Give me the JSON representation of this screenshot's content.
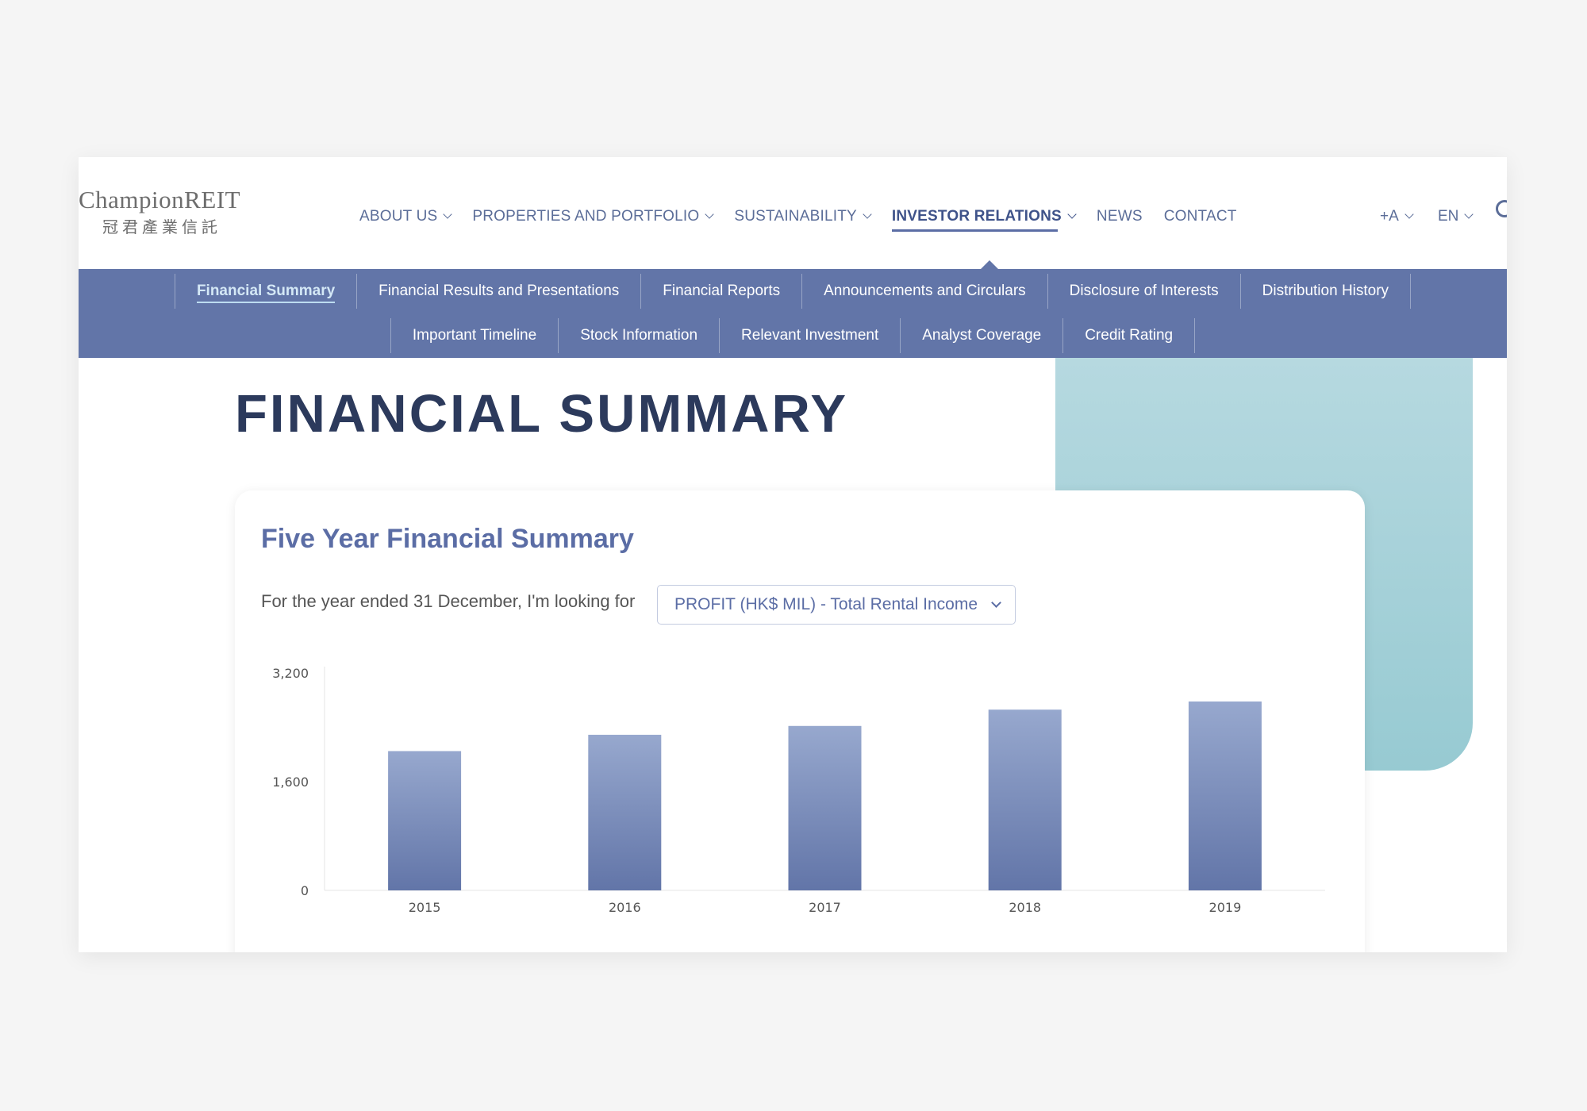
{
  "header": {
    "logo_en": "ChampionREIT",
    "logo_cn": "冠君產業信託",
    "nav": [
      {
        "label": "ABOUT US",
        "dropdown": true
      },
      {
        "label": "PROPERTIES AND PORTFOLIO",
        "dropdown": true
      },
      {
        "label": "SUSTAINABILITY",
        "dropdown": true
      },
      {
        "label": "INVESTOR RELATIONS",
        "dropdown": true,
        "active": true
      },
      {
        "label": "NEWS",
        "dropdown": false
      },
      {
        "label": "CONTACT",
        "dropdown": false
      }
    ],
    "font_size_label": "+A",
    "language_label": "EN",
    "search_icon": "search-icon"
  },
  "subnav": {
    "row1": [
      "Financial Summary",
      "Financial Results and Presentations",
      "Financial Reports",
      "Announcements and Circulars",
      "Disclosure of Interests",
      "Distribution History"
    ],
    "row2": [
      "Important Timeline",
      "Stock Information",
      "Relevant Investment",
      "Analyst Coverage",
      "Credit Rating"
    ],
    "active": "Financial Summary"
  },
  "page": {
    "title": "FINANCIAL SUMMARY"
  },
  "summary": {
    "title": "Five Year Financial Summary",
    "filter_label": "For the year ended 31 December, I'm looking for",
    "filter_value": "PROFIT (HK$ MIL) - Total Rental Income"
  },
  "colors": {
    "accent": "#5b6da5",
    "subnav_bg": "#6275a8",
    "title": "#2c3a5c",
    "teal": "#a7d2d9",
    "bar_top": "#97a8ce",
    "bar_bottom": "#6275a8"
  },
  "chart_data": {
    "type": "bar",
    "categories": [
      "2015",
      "2016",
      "2017",
      "2018",
      "2019"
    ],
    "values": [
      2050,
      2290,
      2420,
      2660,
      2780
    ],
    "ylim": [
      0,
      3200
    ],
    "yticks": [
      0,
      1600,
      3200
    ],
    "ytick_labels": [
      "0",
      "1,600",
      "3,200"
    ],
    "title": "",
    "xlabel": "",
    "ylabel": "",
    "grid": false,
    "legend": "none"
  }
}
